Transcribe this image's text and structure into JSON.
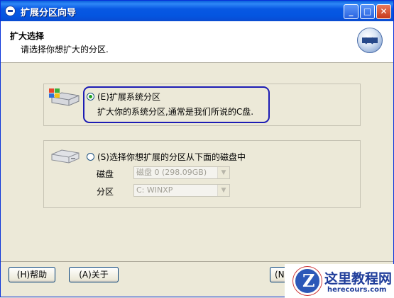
{
  "window": {
    "title": "扩展分区向导",
    "controls": {
      "minimize": "_",
      "maximize": "□",
      "close": "✕"
    }
  },
  "header": {
    "title": "扩大选择",
    "subtitle": "请选择你想扩大的分区."
  },
  "option1": {
    "label": "(E)扩展系统分区",
    "selected": true,
    "description": "扩大你的系统分区,通常是我们所说的C盘."
  },
  "option2": {
    "label": "(S)选择你想扩展的分区从下面的磁盘中",
    "selected": false,
    "disk_label": "磁盘",
    "disk_value": "磁盘 0 (298.09GB)",
    "partition_label": "分区",
    "partition_value": "C: WINXP"
  },
  "buttons": {
    "help": "(H)帮助",
    "about": "(A)关于",
    "next": "(N)下"
  },
  "watermark": {
    "cn": "这里教程网",
    "en": "herecours.com"
  }
}
